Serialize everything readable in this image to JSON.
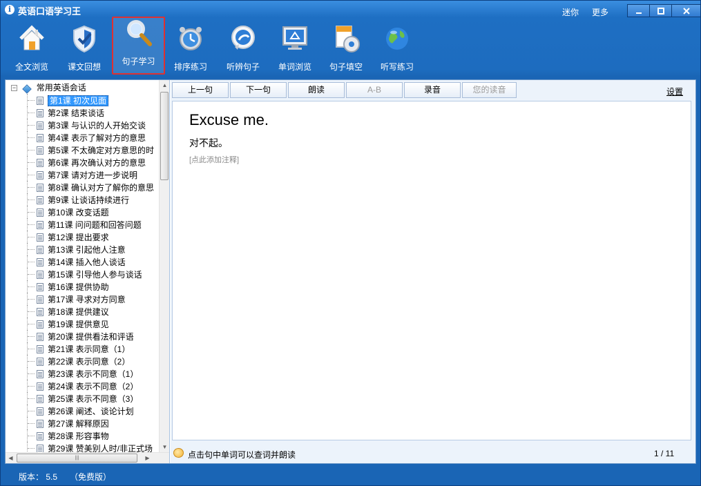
{
  "window": {
    "title": "英语口语学习王",
    "links": [
      "迷你",
      "更多"
    ],
    "controls": [
      "minimize",
      "maximize",
      "close"
    ]
  },
  "toolbar": {
    "items": [
      {
        "label": "全文浏览",
        "icon": "home-icon"
      },
      {
        "label": "课文回想",
        "icon": "shield-check-icon"
      },
      {
        "label": "句子学习",
        "icon": "magnifier-icon",
        "active": true
      },
      {
        "label": "排序练习",
        "icon": "alarm-clock-icon"
      },
      {
        "label": "听辨句子",
        "icon": "speech-bubble-icon"
      },
      {
        "label": "单词浏览",
        "icon": "monitor-recycle-icon"
      },
      {
        "label": "句子填空",
        "icon": "document-disc-icon"
      },
      {
        "label": "听写练习",
        "icon": "globe-icon"
      }
    ]
  },
  "tree": {
    "root_label": "常用英语会话",
    "items": [
      "第1课 初次见面",
      "第2课 结束谈话",
      "第3课 与认识的人开始交谈",
      "第4课 表示了解对方的意思",
      "第5课 不太确定对方意思的时",
      "第6课 再次确认对方的意思",
      "第7课 请对方进一步说明",
      "第8课 确认对方了解你的意思",
      "第9课 让谈话持续进行",
      "第10课 改变话题",
      "第11课 问问题和回答问题",
      "第12课 提出要求",
      "第13课 引起他人注意",
      "第14课 插入他人谈话",
      "第15课 引导他人参与谈话",
      "第16课 提供协助",
      "第17课 寻求对方同意",
      "第18课 提供建议",
      "第19课 提供意见",
      "第20课 提供看法和评语",
      "第21课 表示同意（1）",
      "第22课 表示同意（2）",
      "第23课 表示不同意（1）",
      "第24课 表示不同意（2）",
      "第25课 表示不同意（3）",
      "第26课 阐述、谈论计划",
      "第27课 解释原因",
      "第28课 形容事物",
      "第29课 赞美别人时/非正式场"
    ],
    "selected_index": 0
  },
  "actions": {
    "buttons": [
      {
        "label": "上一句",
        "enabled": true
      },
      {
        "label": "下一句",
        "enabled": true
      },
      {
        "label": "朗读",
        "enabled": true
      },
      {
        "label": "A-B",
        "enabled": false
      },
      {
        "label": "录音",
        "enabled": true
      },
      {
        "label": "您的读音",
        "enabled": false
      }
    ],
    "settings_label": "设置"
  },
  "sentence": {
    "english": "Excuse me.",
    "chinese": "对不起。",
    "note_placeholder": "[点此添加注释]"
  },
  "status": {
    "tip": "点击句中单词可以查词并朗读",
    "pager": "1 / 11"
  },
  "footer": {
    "version": "版本：  5.5",
    "edition": "（免费版）"
  }
}
